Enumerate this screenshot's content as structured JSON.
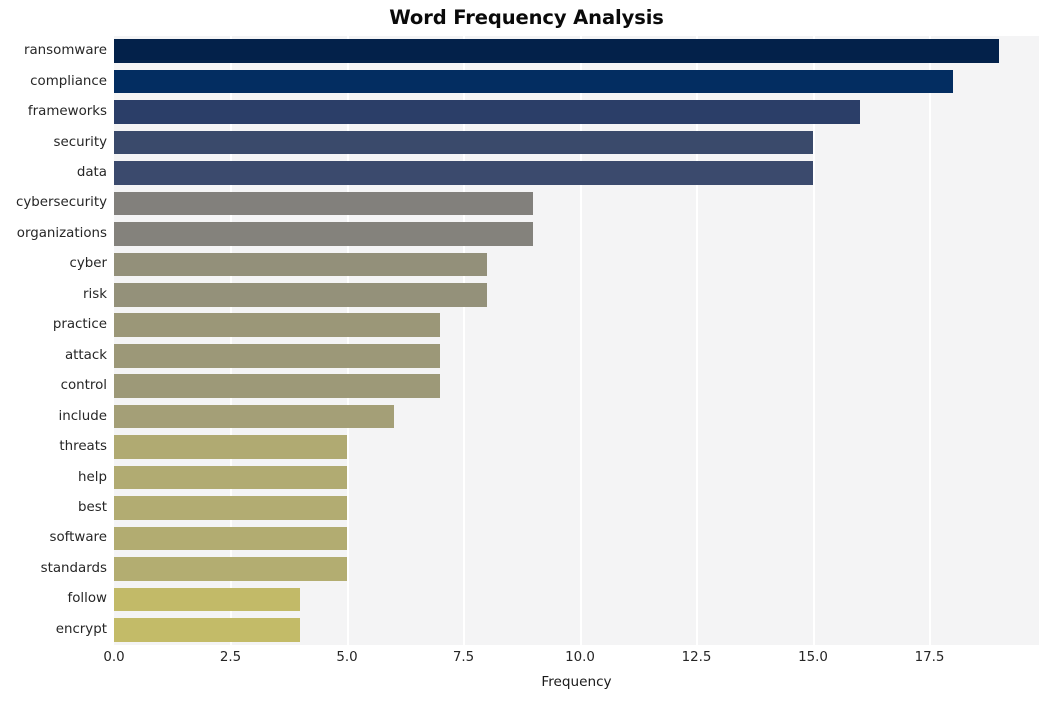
{
  "chart_data": {
    "type": "bar",
    "orientation": "horizontal",
    "title": "Word Frequency Analysis",
    "xlabel": "Frequency",
    "ylabel": "",
    "xlim": [
      0,
      19.85
    ],
    "xticks": [
      "0.0",
      "2.5",
      "5.0",
      "7.5",
      "10.0",
      "12.5",
      "15.0",
      "17.5"
    ],
    "xtick_values": [
      0,
      2.5,
      5,
      7.5,
      10,
      12.5,
      15,
      17.5
    ],
    "grid": true,
    "grid_axis": "x",
    "legend": false,
    "categories": [
      "ransomware",
      "compliance",
      "frameworks",
      "security",
      "data",
      "cybersecurity",
      "organizations",
      "cyber",
      "risk",
      "practice",
      "attack",
      "control",
      "include",
      "threats",
      "help",
      "best",
      "software",
      "standards",
      "follow",
      "encrypt"
    ],
    "values": [
      19,
      18,
      16,
      15,
      15,
      9,
      9,
      8,
      8,
      7,
      7,
      7,
      6,
      5,
      5,
      5,
      5,
      5,
      4,
      4
    ],
    "bar_colors": [
      "#03214a",
      "#032d61",
      "#2b3e६8",
      "#3a4a6b",
      "#3b4a6d",
      "#82807c",
      "#84827c",
      "#93907a",
      "#94917a",
      "#9b9778",
      "#9c9878",
      "#9d9978",
      "#a49f77",
      "#b0aa72",
      "#b1ab72",
      "#b2ac72",
      "#b2ac71",
      "#b3ad71",
      "#c2ba68",
      "#c3bb68"
    ],
    "plot_background": "#f4f4f5",
    "gridline_color": "#ffffff"
  }
}
